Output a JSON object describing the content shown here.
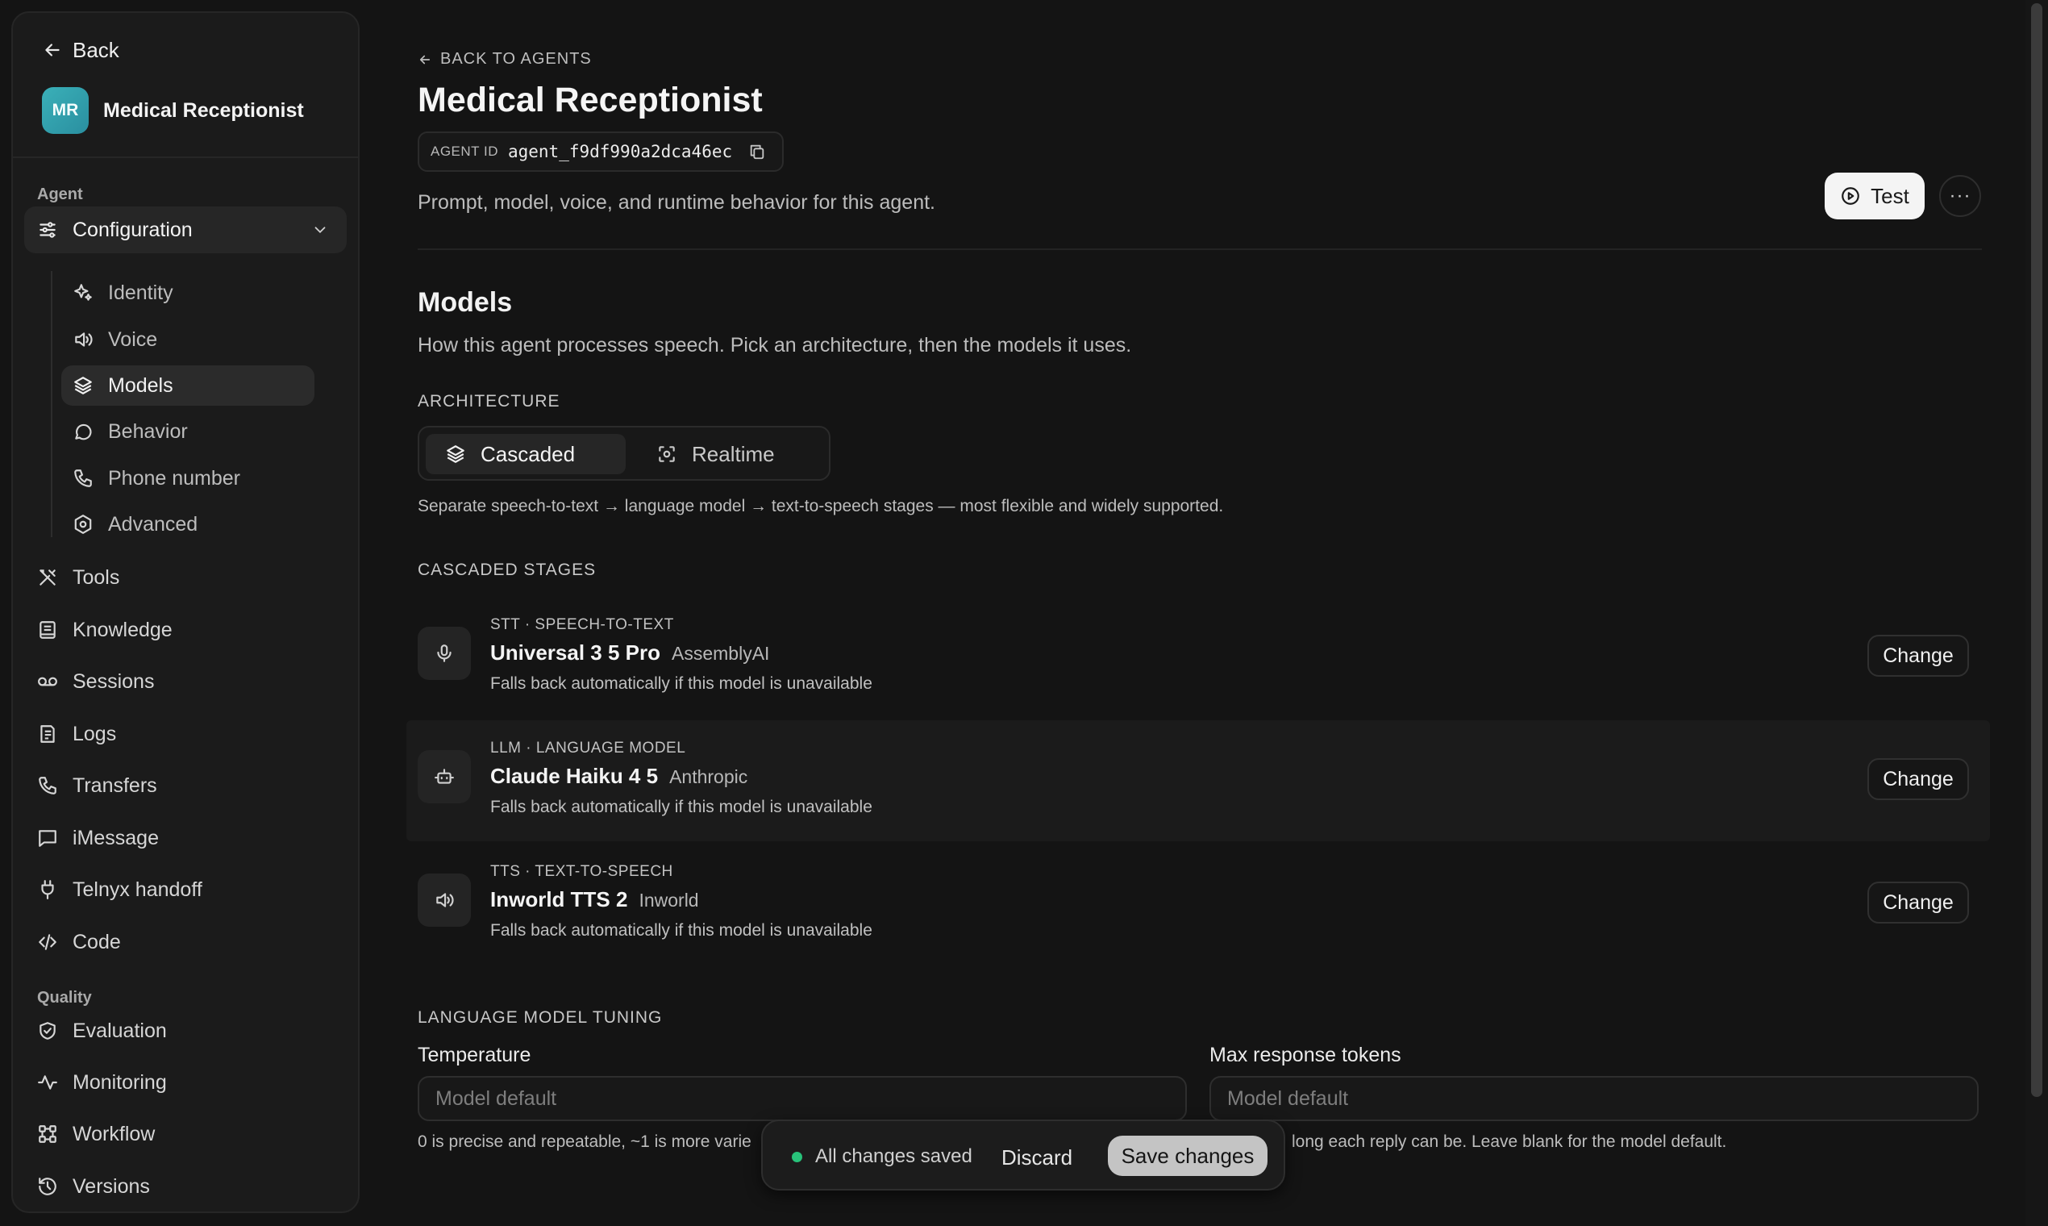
{
  "sidebar": {
    "back_label": "Back",
    "agent": {
      "initials": "MR",
      "name": "Medical Receptionist"
    },
    "agent_section_label": "Agent",
    "configuration": {
      "label": "Configuration",
      "items": [
        {
          "label": "Identity",
          "icon": "sparkles-icon"
        },
        {
          "label": "Voice",
          "icon": "speaker-icon"
        },
        {
          "label": "Models",
          "icon": "layers-icon",
          "active": true
        },
        {
          "label": "Behavior",
          "icon": "chat-bubble-icon"
        },
        {
          "label": "Phone number",
          "icon": "phone-icon"
        },
        {
          "label": "Advanced",
          "icon": "gear-icon"
        }
      ]
    },
    "agent_items": [
      {
        "label": "Tools",
        "icon": "tools-icon"
      },
      {
        "label": "Knowledge",
        "icon": "book-icon"
      },
      {
        "label": "Sessions",
        "icon": "voicemail-icon"
      },
      {
        "label": "Logs",
        "icon": "log-icon"
      },
      {
        "label": "Transfers",
        "icon": "phone-forward-icon"
      },
      {
        "label": "iMessage",
        "icon": "message-icon"
      },
      {
        "label": "Telnyx handoff",
        "icon": "plug-icon"
      },
      {
        "label": "Code",
        "icon": "code-icon"
      }
    ],
    "quality_section_label": "Quality",
    "quality_items": [
      {
        "label": "Evaluation",
        "icon": "shield-check-icon"
      },
      {
        "label": "Monitoring",
        "icon": "activity-icon"
      },
      {
        "label": "Workflow",
        "icon": "workflow-icon"
      },
      {
        "label": "Versions",
        "icon": "history-icon"
      }
    ]
  },
  "header": {
    "back_link": "BACK TO AGENTS",
    "title": "Medical Receptionist",
    "agent_id_label": "AGENT ID",
    "agent_id": "agent_f9df990a2dca46ec",
    "description": "Prompt, model, voice, and runtime behavior for this agent.",
    "test_label": "Test",
    "more_label": "···"
  },
  "models": {
    "title": "Models",
    "description": "How this agent processes speech. Pick an architecture, then the models it uses.",
    "architecture_label": "ARCHITECTURE",
    "architecture_options": [
      "Cascaded",
      "Realtime"
    ],
    "architecture_selected": "Cascaded",
    "architecture_hint": "Separate speech-to-text → language model → text-to-speech stages — most flexible and widely supported.",
    "stages_label": "CASCADED STAGES",
    "stages": [
      {
        "kind": "STT · SPEECH-TO-TEXT",
        "model": "Universal 3 5 Pro",
        "provider": "AssemblyAI",
        "note": "Falls back automatically if this model is unavailable",
        "action": "Change",
        "icon": "microphone-icon"
      },
      {
        "kind": "LLM · LANGUAGE MODEL",
        "model": "Claude Haiku 4 5",
        "provider": "Anthropic",
        "note": "Falls back automatically if this model is unavailable",
        "action": "Change",
        "icon": "robot-icon"
      },
      {
        "kind": "TTS · TEXT-TO-SPEECH",
        "model": "Inworld TTS 2",
        "provider": "Inworld",
        "note": "Falls back automatically if this model is unavailable",
        "action": "Change",
        "icon": "speaker-icon"
      }
    ],
    "tuning_label": "LANGUAGE MODEL TUNING",
    "temperature": {
      "label": "Temperature",
      "placeholder": "Model default",
      "value": "",
      "hint": "0 is precise and repeatable, ~1 is more varie"
    },
    "max_tokens": {
      "label": "Max response tokens",
      "placeholder": "Model default",
      "value": "",
      "hint": "long each reply can be. Leave blank for the model default."
    }
  },
  "savebar": {
    "status": "All changes saved",
    "discard_label": "Discard",
    "save_label": "Save changes",
    "status_color": "#28c27a"
  }
}
